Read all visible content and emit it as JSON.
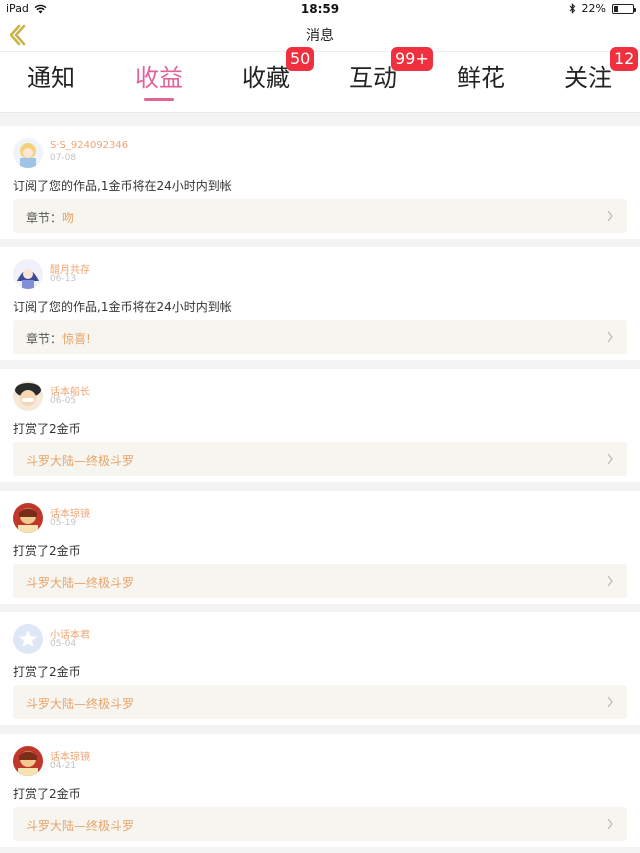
{
  "status_bar": {
    "device": "iPad",
    "time": "18:59",
    "battery": "22%",
    "battery_level": 0.22
  },
  "nav": {
    "title": "消息"
  },
  "tabs": [
    {
      "label": "通知",
      "badge": "",
      "active": false
    },
    {
      "label": "收益",
      "badge": "",
      "active": true
    },
    {
      "label": "收藏",
      "badge": "50",
      "active": false
    },
    {
      "label": "互动",
      "badge": "99+",
      "active": false
    },
    {
      "label": "鲜花",
      "badge": "",
      "active": false
    },
    {
      "label": "关注",
      "badge": "12",
      "active": false
    }
  ],
  "items": [
    {
      "user": "S·S_924092346",
      "date": "07-08",
      "message": "订阅了您的作品,1金币将在24小时内到帐",
      "ref_label": "章节：",
      "ref_text": "吻",
      "avatar": "anime-girl-avatar"
    },
    {
      "user": "醋月共存",
      "date": "06-13",
      "message": "订阅了您的作品,1金币将在24小时内到帐",
      "ref_label": "章节：",
      "ref_text": "惊喜!",
      "avatar": "anime-character-avatar"
    },
    {
      "user": "话本船长",
      "date": "06-05",
      "message": "打赏了2金币",
      "ref_label": "",
      "ref_text": "斗罗大陆—终极斗罗",
      "avatar": "pirate-captain-avatar"
    },
    {
      "user": "话本琼镜",
      "date": "05-19",
      "message": "打赏了2金币",
      "ref_label": "",
      "ref_text": "斗罗大陆—终极斗罗",
      "avatar": "character-avatar"
    },
    {
      "user": "小话本君",
      "date": "05-04",
      "message": "打赏了2金币",
      "ref_label": "",
      "ref_text": "斗罗大陆—终极斗罗",
      "avatar": "default-star-avatar"
    },
    {
      "user": "话本琼镜",
      "date": "04-21",
      "message": "打赏了2金币",
      "ref_label": "",
      "ref_text": "斗罗大陆—终极斗罗",
      "avatar": "character-avatar"
    }
  ],
  "colors": {
    "accent": "#e2629a",
    "badge": "#f0303f",
    "username": "#f0a472",
    "ref_text": "#e9a368",
    "back_arrow": "#c9b44a"
  }
}
